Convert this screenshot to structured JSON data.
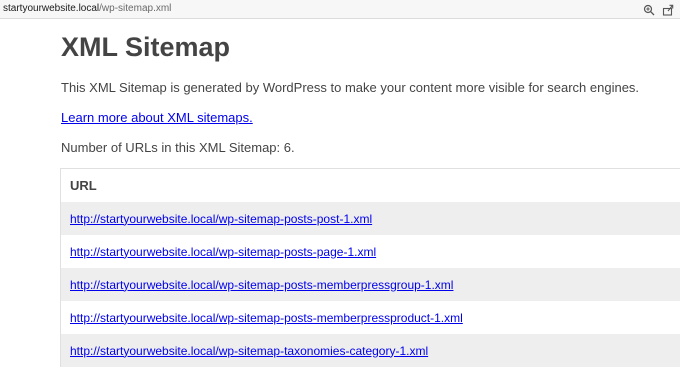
{
  "browser": {
    "url_host": "startyourwebsite.local",
    "url_path": "/wp-sitemap.xml",
    "icons": [
      "zoom-in-icon",
      "share-icon"
    ]
  },
  "page": {
    "title": "XML Sitemap",
    "description": "This XML Sitemap is generated by WordPress to make your content more visible for search engines.",
    "learn_more_link": "Learn more about XML sitemaps.",
    "url_count_text": "Number of URLs in this XML Sitemap: 6."
  },
  "table": {
    "header": "URL",
    "rows": [
      "http://startyourwebsite.local/wp-sitemap-posts-post-1.xml",
      "http://startyourwebsite.local/wp-sitemap-posts-page-1.xml",
      "http://startyourwebsite.local/wp-sitemap-posts-memberpressgroup-1.xml",
      "http://startyourwebsite.local/wp-sitemap-posts-memberpressproduct-1.xml",
      "http://startyourwebsite.local/wp-sitemap-taxonomies-category-1.xml"
    ]
  },
  "colors": {
    "link": "#0000ee",
    "text": "#444444",
    "row_stripe": "#eeeeee"
  }
}
